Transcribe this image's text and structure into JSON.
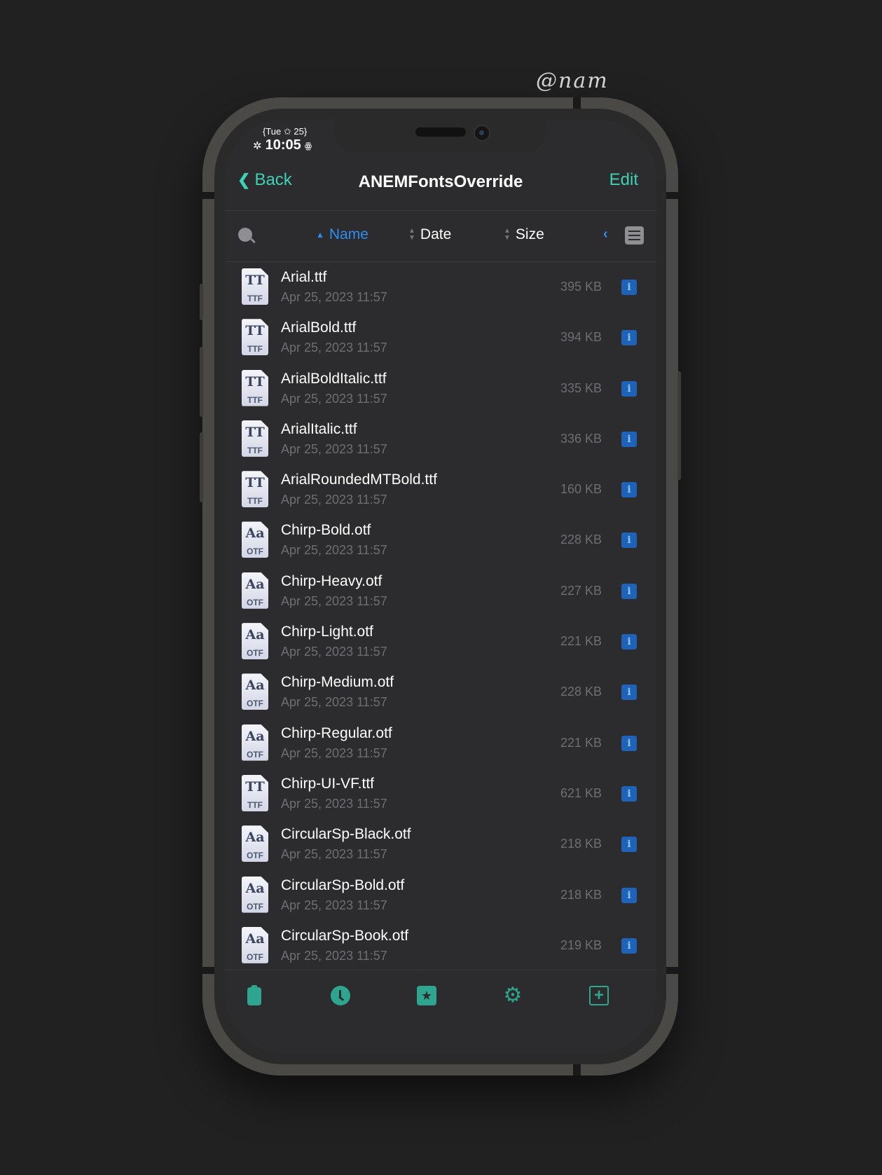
{
  "signature": "@nam",
  "status": {
    "date": "{Tue ✩ 25}",
    "time": "10:05"
  },
  "nav": {
    "back_label": "Back",
    "title": "ANEMFontsOverride",
    "edit_label": "Edit"
  },
  "sort": {
    "name_label": "Name",
    "date_label": "Date",
    "size_label": "Size",
    "active": "Name"
  },
  "files": [
    {
      "name": "Arial.ttf",
      "date": "Apr 25, 2023 11:57",
      "size": "395 KB",
      "type": "TTF",
      "glyph": "TT"
    },
    {
      "name": "ArialBold.ttf",
      "date": "Apr 25, 2023 11:57",
      "size": "394 KB",
      "type": "TTF",
      "glyph": "TT"
    },
    {
      "name": "ArialBoldItalic.ttf",
      "date": "Apr 25, 2023 11:57",
      "size": "335 KB",
      "type": "TTF",
      "glyph": "TT"
    },
    {
      "name": "ArialItalic.ttf",
      "date": "Apr 25, 2023 11:57",
      "size": "336 KB",
      "type": "TTF",
      "glyph": "TT"
    },
    {
      "name": "ArialRoundedMTBold.ttf",
      "date": "Apr 25, 2023 11:57",
      "size": "160 KB",
      "type": "TTF",
      "glyph": "TT"
    },
    {
      "name": "Chirp-Bold.otf",
      "date": "Apr 25, 2023 11:57",
      "size": "228 KB",
      "type": "OTF",
      "glyph": "Aa"
    },
    {
      "name": "Chirp-Heavy.otf",
      "date": "Apr 25, 2023 11:57",
      "size": "227 KB",
      "type": "OTF",
      "glyph": "Aa"
    },
    {
      "name": "Chirp-Light.otf",
      "date": "Apr 25, 2023 11:57",
      "size": "221 KB",
      "type": "OTF",
      "glyph": "Aa"
    },
    {
      "name": "Chirp-Medium.otf",
      "date": "Apr 25, 2023 11:57",
      "size": "228 KB",
      "type": "OTF",
      "glyph": "Aa"
    },
    {
      "name": "Chirp-Regular.otf",
      "date": "Apr 25, 2023 11:57",
      "size": "221 KB",
      "type": "OTF",
      "glyph": "Aa"
    },
    {
      "name": "Chirp-UI-VF.ttf",
      "date": "Apr 25, 2023 11:57",
      "size": "621 KB",
      "type": "TTF",
      "glyph": "TT"
    },
    {
      "name": "CircularSp-Black.otf",
      "date": "Apr 25, 2023 11:57",
      "size": "218 KB",
      "type": "OTF",
      "glyph": "Aa"
    },
    {
      "name": "CircularSp-Bold.otf",
      "date": "Apr 25, 2023 11:57",
      "size": "218 KB",
      "type": "OTF",
      "glyph": "Aa"
    },
    {
      "name": "CircularSp-Book.otf",
      "date": "Apr 25, 2023 11:57",
      "size": "219 KB",
      "type": "OTF",
      "glyph": "Aa"
    }
  ],
  "tabbar": {
    "items": [
      "clipboard-icon",
      "clock-icon",
      "star-icon",
      "gear-icon",
      "add-icon"
    ]
  },
  "colors": {
    "accent": "#3ed1b4",
    "link": "#2f8cf0",
    "background": "#2c2c2e"
  }
}
